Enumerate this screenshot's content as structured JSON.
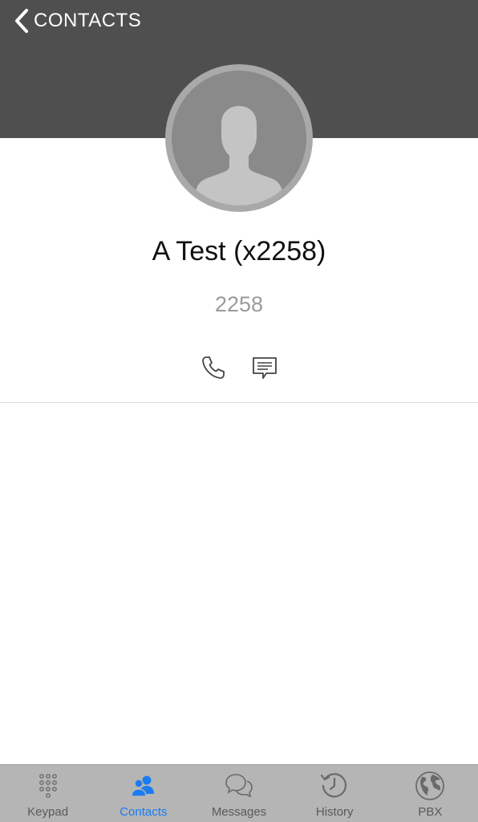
{
  "header": {
    "back_label": "CONTACTS",
    "background": "#4f4f4f"
  },
  "contact": {
    "name": "A Test (x2258)",
    "number": "2258"
  },
  "actions": [
    {
      "icon": "phone-icon"
    },
    {
      "icon": "message-icon"
    }
  ],
  "tabbar": {
    "active_color": "#1a7cf0",
    "items": [
      {
        "label": "Keypad",
        "icon": "keypad-icon",
        "active": false
      },
      {
        "label": "Contacts",
        "icon": "contacts-icon",
        "active": true
      },
      {
        "label": "Messages",
        "icon": "messages-icon",
        "active": false
      },
      {
        "label": "History",
        "icon": "history-icon",
        "active": false
      },
      {
        "label": "PBX",
        "icon": "globe-icon",
        "active": false
      }
    ]
  }
}
